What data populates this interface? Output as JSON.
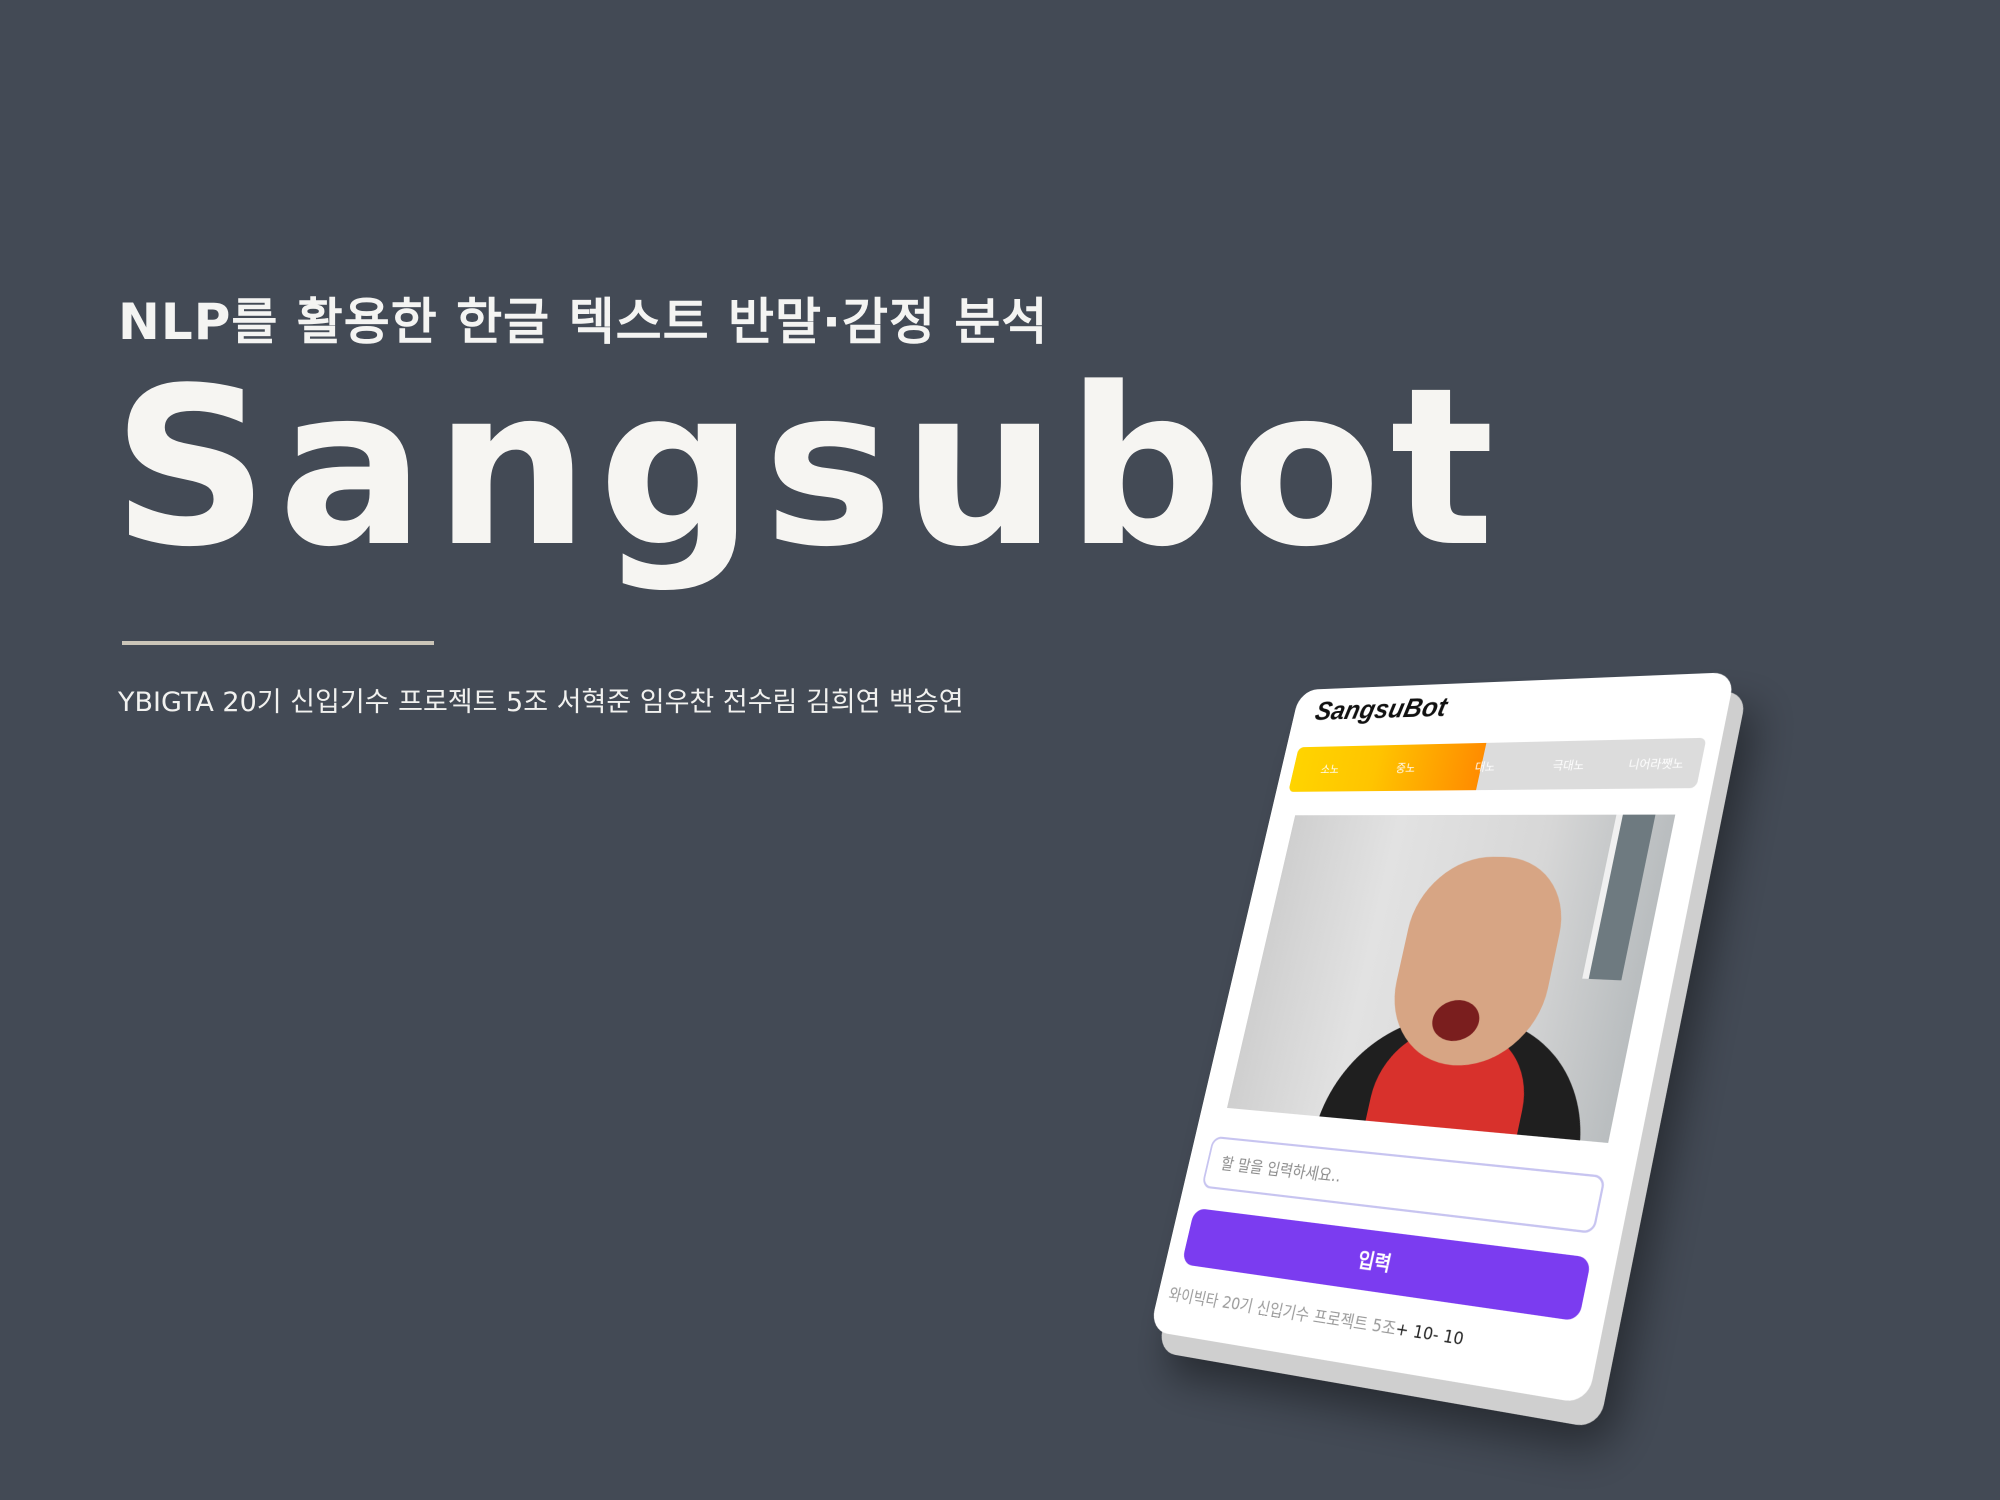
{
  "slide": {
    "subtitle": "NLP를 활용한 한글 텍스트 반말·감정 분석",
    "title": "Sangsubot",
    "credits": "YBIGTA 20기 신입기수 프로젝트 5조 서혁준 임우찬 전수림 김희연 백승연"
  },
  "app": {
    "title": "SangsuBot",
    "anger_levels": [
      "소노",
      "중노",
      "대노",
      "극대노",
      "니어라쨋노"
    ],
    "anger_level_fill": 0.49,
    "image_alt": "사용자 얼굴 이미지",
    "input_placeholder": "할 말을 입력하세요..",
    "submit_label": "입력",
    "footer_text": "와이빅타 20기 신입기수 프로젝트 5조",
    "footer_counter": "+ 10- 10"
  },
  "colors": {
    "background": "#434a55",
    "accent_button": "#7b3cf0",
    "bar_fill_start": "#ffd400",
    "bar_fill_end": "#ff8c00"
  }
}
